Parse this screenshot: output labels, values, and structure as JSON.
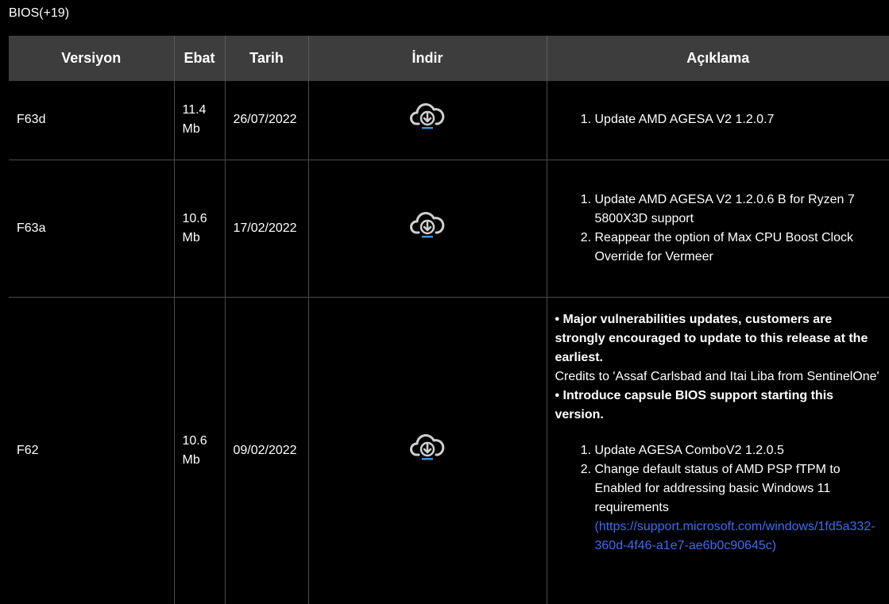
{
  "section": {
    "title": "BIOS(+19)"
  },
  "table": {
    "headers": {
      "version": "Versiyon",
      "size": "Ebat",
      "date": "Tarih",
      "download": "İndir",
      "description": "Açıklama"
    },
    "rows": [
      {
        "version": "F63d",
        "size_line1": "11.4",
        "size_line2": "Mb",
        "date": "26/07/2022",
        "items": [
          "Update AMD AGESA V2 1.2.0.7"
        ]
      },
      {
        "version": "F63a",
        "size_line1": "10.6",
        "size_line2": "Mb",
        "date": "17/02/2022",
        "items": [
          "Update AMD AGESA V2 1.2.0.6 B for Ryzen 7 5800X3D support",
          "Reappear the option of Max CPU Boost Clock Override for Vermeer"
        ]
      },
      {
        "version": "F62",
        "size_line1": "10.6",
        "size_line2": "Mb",
        "date": "09/02/2022",
        "bullet1": "• Major vulnerabilities updates, customers are strongly encouraged to update to this release at the earliest.",
        "credits": "Credits to 'Assaf Carlsbad and Itai Liba from SentinelOne'",
        "bullet2": "• Introduce capsule BIOS support starting this version.",
        "items": [
          "Update AGESA ComboV2 1.2.0.5",
          "Change default status of AMD PSP fTPM to Enabled for addressing basic Windows 11 requirements"
        ],
        "link": "(https://support.microsoft.com/windows/1fd5a332-360d-4f46-a1e7-ae6b0c90645c)"
      }
    ]
  },
  "colors": {
    "background": "#000000",
    "header_bg": "#3d3d3d",
    "link": "#3b6cf5",
    "icon_stroke": "#cfcfcf",
    "icon_accent": "#3b8fe0"
  },
  "icons": {
    "download": "cloud-download-icon"
  }
}
